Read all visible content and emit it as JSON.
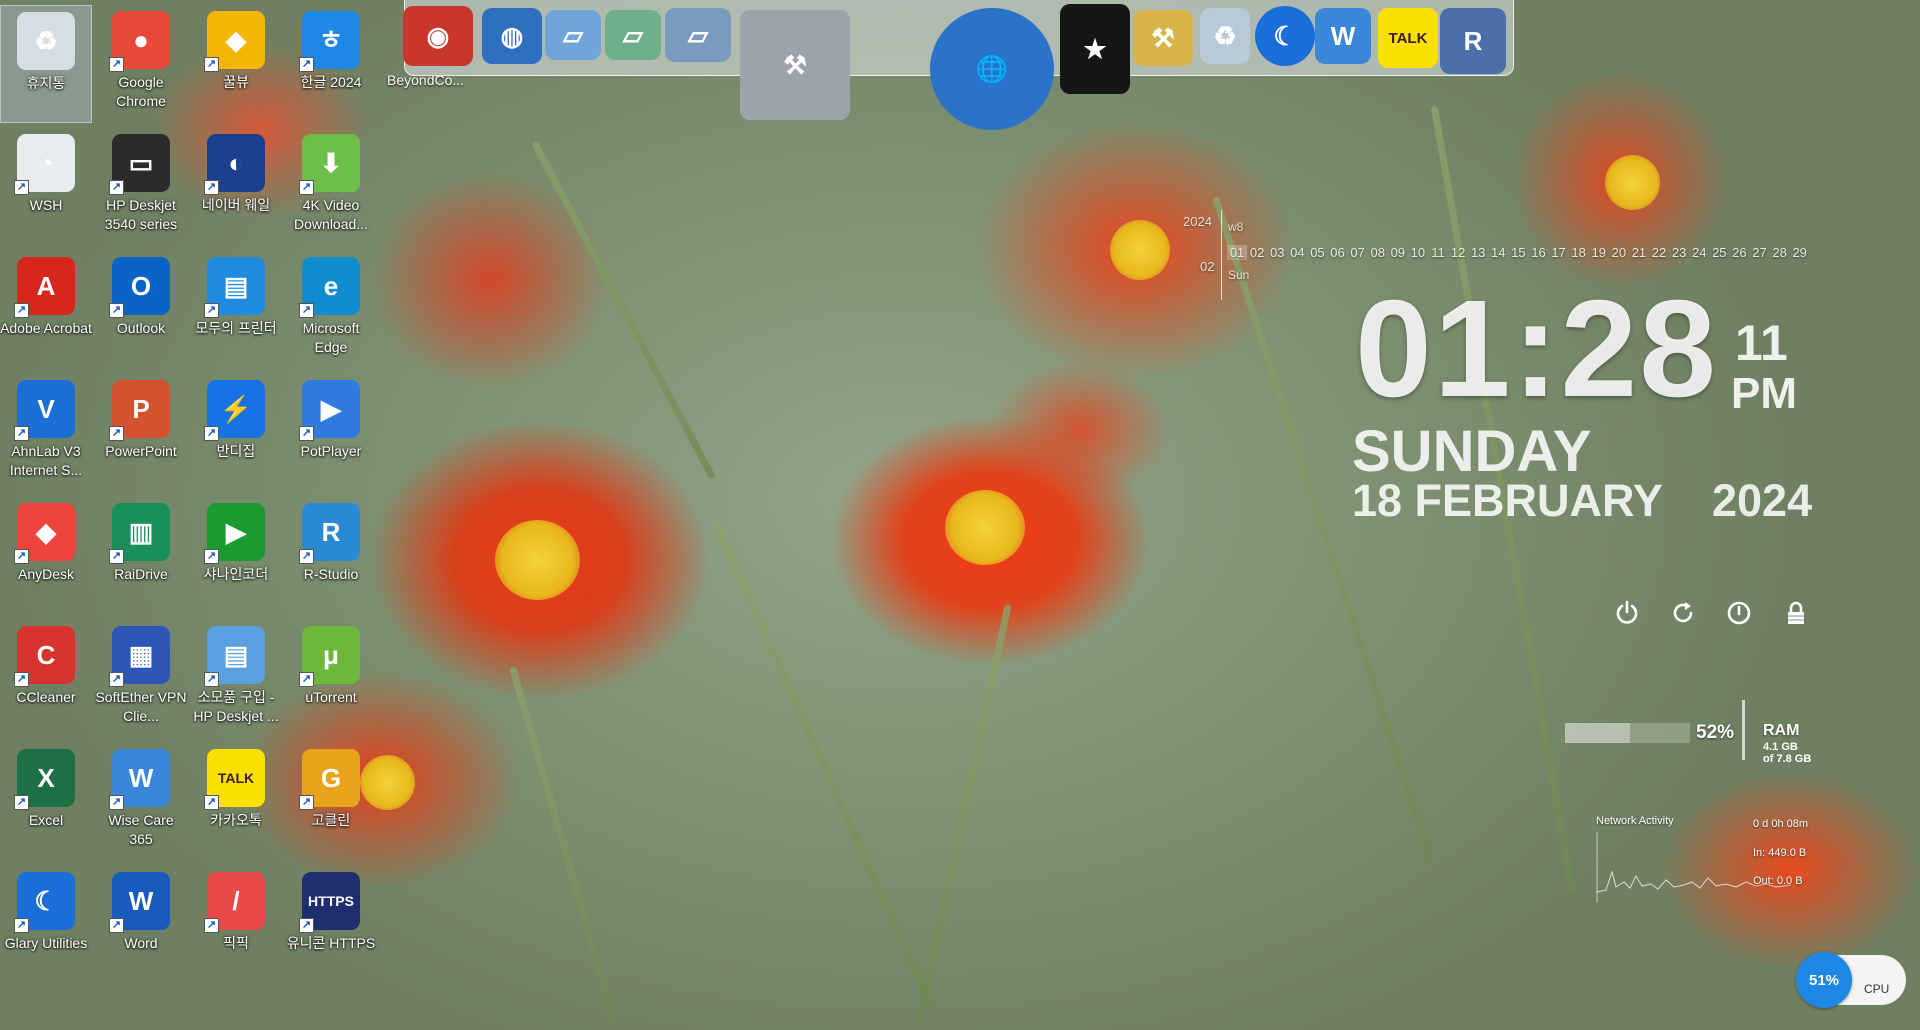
{
  "desktop_icons": [
    {
      "label": "휴지통",
      "name": "recycle-bin-icon",
      "color": "#d6dde4",
      "symbol": "♻",
      "selected": true
    },
    {
      "label": "Google Chrome",
      "name": "chrome-icon",
      "color": "#e9493a",
      "symbol": "●"
    },
    {
      "label": "꿀뷰",
      "name": "honeyview-icon",
      "color": "#f2b705",
      "symbol": "◆"
    },
    {
      "label": "한글 2024",
      "name": "hangul-icon",
      "color": "#1e88e5",
      "symbol": "ㅎ"
    },
    {
      "label": "WSH",
      "name": "wsh-icon",
      "color": "#e9ecef",
      "symbol": "◔"
    },
    {
      "label": "HP Deskjet 3540 series",
      "name": "hp-printer-icon",
      "color": "#2b2b2b",
      "symbol": "▭"
    },
    {
      "label": "네이버 웨일",
      "name": "naver-whale-icon",
      "color": "#1d3f8f",
      "symbol": "◐"
    },
    {
      "label": "4K Video Download...",
      "name": "4k-video-downloader-icon",
      "color": "#6cc04a",
      "symbol": "⬇"
    },
    {
      "label": "Adobe Acrobat",
      "name": "adobe-acrobat-icon",
      "color": "#d7261e",
      "symbol": "A"
    },
    {
      "label": "Outlook",
      "name": "outlook-icon",
      "color": "#0a64c8",
      "symbol": "O"
    },
    {
      "label": "모두의 프린터",
      "name": "modu-printer-icon",
      "color": "#1f8bde",
      "symbol": "▤"
    },
    {
      "label": "Microsoft Edge",
      "name": "edge-icon",
      "color": "#0f8dcf",
      "symbol": "e"
    },
    {
      "label": "AhnLab V3 Internet S...",
      "name": "ahnlab-v3-icon",
      "color": "#1a6fd6",
      "symbol": "V"
    },
    {
      "label": "PowerPoint",
      "name": "powerpoint-icon",
      "color": "#d35230",
      "symbol": "P"
    },
    {
      "label": "반디집",
      "name": "bandizip-icon",
      "color": "#1673e3",
      "symbol": "⚡"
    },
    {
      "label": "PotPlayer",
      "name": "potplayer-icon",
      "color": "#2f7be0",
      "symbol": "▶"
    },
    {
      "label": "AnyDesk",
      "name": "anydesk-icon",
      "color": "#ef443b",
      "symbol": "◆"
    },
    {
      "label": "RaiDrive",
      "name": "raidrive-icon",
      "color": "#1a8f5a",
      "symbol": "▥"
    },
    {
      "label": "샤나인코더",
      "name": "shana-encoder-icon",
      "color": "#1b9b2f",
      "symbol": "▶"
    },
    {
      "label": "R-Studio",
      "name": "r-studio-icon",
      "color": "#2a89d3",
      "symbol": "R"
    },
    {
      "label": "CCleaner",
      "name": "ccleaner-icon",
      "color": "#d6322e",
      "symbol": "C"
    },
    {
      "label": "SoftEther VPN Clie...",
      "name": "softether-vpn-icon",
      "color": "#2d56b8",
      "symbol": "▦"
    },
    {
      "label": "소모품 구입 - HP Deskjet ...",
      "name": "hp-supplies-icon",
      "color": "#5aa0e0",
      "symbol": "▤"
    },
    {
      "label": "uTorrent",
      "name": "utorrent-icon",
      "color": "#6bb83a",
      "symbol": "μ"
    },
    {
      "label": "Excel",
      "name": "excel-icon",
      "color": "#1d7044",
      "symbol": "X"
    },
    {
      "label": "Wise Care 365",
      "name": "wise-care-icon",
      "color": "#3a86d9",
      "symbol": "W"
    },
    {
      "label": "카카오톡",
      "name": "kakaotalk-icon",
      "color": "#fae100",
      "symbol": "TALK"
    },
    {
      "label": "고클린",
      "name": "goclean-icon",
      "color": "#e8a318",
      "symbol": "G"
    },
    {
      "label": "Glary Utilities",
      "name": "glary-utilities-icon",
      "color": "#1a6ed8",
      "symbol": "☾"
    },
    {
      "label": "Word",
      "name": "word-icon",
      "color": "#185abd",
      "symbol": "W"
    },
    {
      "label": "픽픽",
      "name": "picpick-icon",
      "color": "#e84a4a",
      "symbol": "/"
    },
    {
      "label": "유니콘 HTTPS",
      "name": "unicorn-https-icon",
      "color": "#1f2e6e",
      "symbol": "HTTPS"
    }
  ],
  "dock": {
    "beyond_label": "BeyondCo...",
    "items": [
      {
        "name": "beyond-compare-icon",
        "color": "#c9362e",
        "symbol": "◉"
      },
      {
        "name": "web-browser-icon",
        "color": "#2f6fc0",
        "symbol": "◍"
      },
      {
        "name": "folder-icon",
        "color": "#6fa5d8",
        "symbol": "▱"
      },
      {
        "name": "green-folder-icon",
        "color": "#6db08a",
        "symbol": "▱"
      },
      {
        "name": "picture-folder-icon",
        "color": "#7a9bbd",
        "symbol": "▱"
      },
      {
        "name": "tools-icon",
        "color": "#9ca3ab",
        "symbol": "⚒"
      },
      {
        "name": "globe-icon",
        "color": "#2a73c9",
        "symbol": "🌐"
      },
      {
        "name": "tshirt-icon",
        "color": "#161616",
        "symbol": "★"
      },
      {
        "name": "hammer-icon",
        "color": "#d7b34a",
        "symbol": "⚒"
      },
      {
        "name": "trash-icon",
        "color": "#b8c9d8",
        "symbol": "♻"
      },
      {
        "name": "glary-dock-icon",
        "color": "#1a6ed8",
        "symbol": "☾"
      },
      {
        "name": "wise-dock-icon",
        "color": "#3a86d9",
        "symbol": "W"
      },
      {
        "name": "kakaotalk-dock-icon",
        "color": "#fae100",
        "symbol": "TALK"
      },
      {
        "name": "r-tool-icon",
        "color": "#4b6fa8",
        "symbol": "R"
      }
    ]
  },
  "calendar": {
    "year": "2024",
    "month": "02",
    "week": "w8",
    "dayname": "Sun",
    "days": [
      "01",
      "02",
      "03",
      "04",
      "05",
      "06",
      "07",
      "08",
      "09",
      "10",
      "11",
      "12",
      "13",
      "14",
      "15",
      "16",
      "17",
      "18",
      "19",
      "20",
      "21",
      "22",
      "23",
      "24",
      "25",
      "26",
      "27",
      "28",
      "29"
    ]
  },
  "clock": {
    "time": "01:28",
    "seconds": "11",
    "ampm": "PM",
    "day": "SUNDAY",
    "date": "18 FEBRUARY",
    "year": "2024"
  },
  "system": {
    "ram_percent": "52%",
    "ram_fraction": 0.52,
    "ram_label": "RAM",
    "ram_used": "4.1 GB",
    "ram_total": "of 7.8 GB",
    "network_title": "Network Activity",
    "net_uptime": "0 d 0h 08m",
    "net_in": "In: 449.0 B",
    "net_out": "Out: 0.0 B",
    "cpu_percent": "51%",
    "cpu_label": "CPU"
  }
}
